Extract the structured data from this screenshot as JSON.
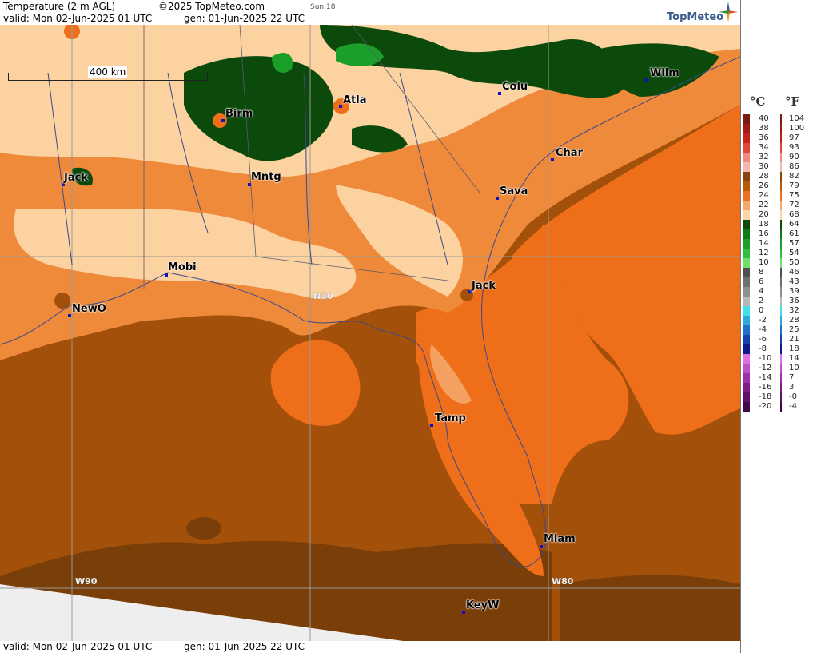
{
  "header": {
    "title": "Temperature (2 m AGL)",
    "copyright": "©2025 TopMeteo.com",
    "day": "Sun 18",
    "valid": "valid:  Mon  02-Jun-2025  01 UTC",
    "gen": "gen:  01-Jun-2025 22 UTC",
    "logo": "TopMeteo"
  },
  "footer": {
    "valid": "valid:  Mon  02-Jun-2025  01 UTC",
    "gen": "gen:  01-Jun-2025 22 UTC"
  },
  "scale_label": "400 km",
  "grid_labels": {
    "lat": "N30",
    "lon_w90": "W90",
    "lon_w80": "W80"
  },
  "cities": [
    {
      "name": "Birm"
    },
    {
      "name": "Atla"
    },
    {
      "name": "Colu"
    },
    {
      "name": "Wilm"
    },
    {
      "name": "Jack"
    },
    {
      "name": "Mntg"
    },
    {
      "name": "Char"
    },
    {
      "name": "Sava"
    },
    {
      "name": "Mobi"
    },
    {
      "name": "Jack"
    },
    {
      "name": "NewO"
    },
    {
      "name": "Tamp"
    },
    {
      "name": "Miam"
    },
    {
      "name": "KeyW"
    }
  ],
  "legend": {
    "unit_c": "°C",
    "unit_f": "°F",
    "rows": [
      {
        "c": "40",
        "f": "104",
        "color": "#7a1a10"
      },
      {
        "c": "38",
        "f": "100",
        "color": "#a01c12"
      },
      {
        "c": "36",
        "f": "97",
        "color": "#c8201a"
      },
      {
        "c": "34",
        "f": "93",
        "color": "#e0483a"
      },
      {
        "c": "32",
        "f": "90",
        "color": "#ee8a80"
      },
      {
        "c": "30",
        "f": "86",
        "color": "#f5b8b0"
      },
      {
        "c": "28",
        "f": "82",
        "color": "#8a4408"
      },
      {
        "c": "26",
        "f": "79",
        "color": "#b85a06"
      },
      {
        "c": "24",
        "f": "75",
        "color": "#ee7020"
      },
      {
        "c": "22",
        "f": "72",
        "color": "#f4a86c"
      },
      {
        "c": "20",
        "f": "68",
        "color": "#fbd6a6"
      },
      {
        "c": "18",
        "f": "64",
        "color": "#0c4a0c"
      },
      {
        "c": "16",
        "f": "61",
        "color": "#0f7a16"
      },
      {
        "c": "14",
        "f": "57",
        "color": "#1aa02a"
      },
      {
        "c": "12",
        "f": "54",
        "color": "#30c040"
      },
      {
        "c": "10",
        "f": "50",
        "color": "#6ee06a"
      },
      {
        "c": "8",
        "f": "46",
        "color": "#505050"
      },
      {
        "c": "6",
        "f": "43",
        "color": "#707070"
      },
      {
        "c": "4",
        "f": "39",
        "color": "#909090"
      },
      {
        "c": "2",
        "f": "36",
        "color": "#b8b8b8"
      },
      {
        "c": "0",
        "f": "32",
        "color": "#40e0e8"
      },
      {
        "c": "-2",
        "f": "28",
        "color": "#30a8e0"
      },
      {
        "c": "-4",
        "f": "25",
        "color": "#2070d0"
      },
      {
        "c": "-6",
        "f": "21",
        "color": "#1840b0"
      },
      {
        "c": "-8",
        "f": "18",
        "color": "#101890"
      },
      {
        "c": "-10",
        "f": "14",
        "color": "#e070e0"
      },
      {
        "c": "-12",
        "f": "10",
        "color": "#c050c8"
      },
      {
        "c": "-14",
        "f": "7",
        "color": "#a030a8"
      },
      {
        "c": "-16",
        "f": "3",
        "color": "#801a88"
      },
      {
        "c": "-18",
        "f": "-0",
        "color": "#601068"
      },
      {
        "c": "-20",
        "f": "-4",
        "color": "#400848"
      }
    ]
  },
  "colors": {
    "gulf_dark": "#a2500a",
    "gulf_deep": "#7a3f08",
    "sea_orange": "#ee6e1a",
    "land_orange": "#f4a060",
    "land_light": "#fbd2a0",
    "forest": "#0c4a0c",
    "forest_light": "#1aa02a",
    "nodata": "#eeeeee"
  }
}
